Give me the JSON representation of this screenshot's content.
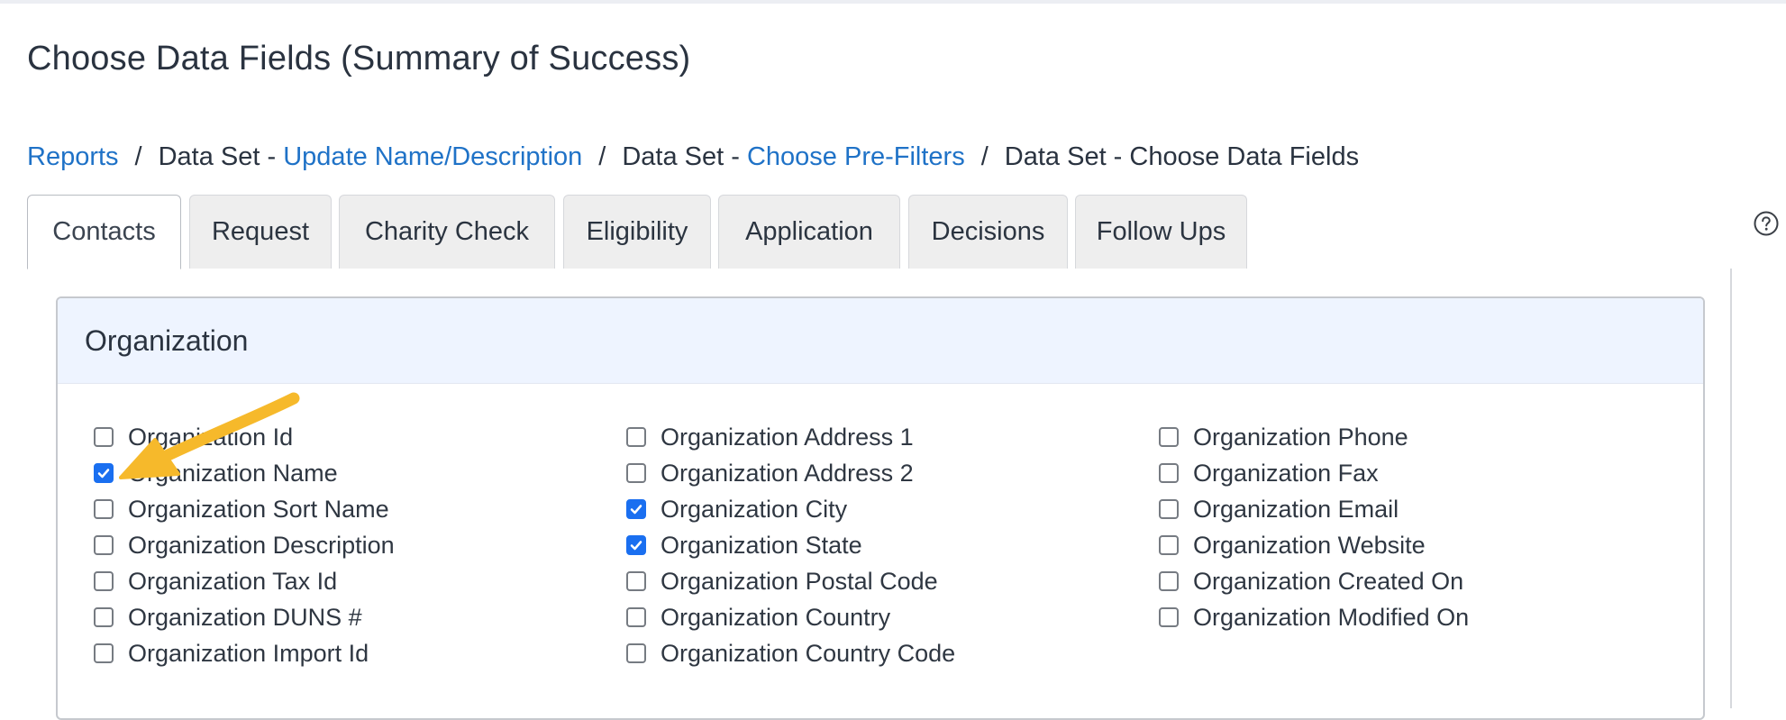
{
  "page": {
    "title": "Choose Data Fields (Summary of Success)"
  },
  "breadcrumb": {
    "reports": "Reports",
    "sep1": "/",
    "ds1_prefix": "Data Set - ",
    "ds1_link": "Update Name/Description",
    "sep2": "/",
    "ds2_prefix": "Data Set - ",
    "ds2_link": "Choose Pre-Filters",
    "sep3": "/",
    "current": "Data Set - Choose Data Fields"
  },
  "tabs": [
    {
      "label": "Contacts",
      "active": true
    },
    {
      "label": "Request"
    },
    {
      "label": "Charity Check"
    },
    {
      "label": "Eligibility"
    },
    {
      "label": "Application"
    },
    {
      "label": "Decisions"
    },
    {
      "label": "Follow Ups"
    }
  ],
  "help": {
    "icon": "question-circle-icon"
  },
  "section": {
    "title": "Organization",
    "columns": [
      [
        {
          "label": "Organization Id",
          "checked": false
        },
        {
          "label": "Organization Name",
          "checked": true
        },
        {
          "label": "Organization Sort Name",
          "checked": false
        },
        {
          "label": "Organization Description",
          "checked": false
        },
        {
          "label": "Organization Tax Id",
          "checked": false
        },
        {
          "label": "Organization DUNS #",
          "checked": false
        },
        {
          "label": "Organization Import Id",
          "checked": false
        }
      ],
      [
        {
          "label": "Organization Address 1",
          "checked": false
        },
        {
          "label": "Organization Address 2",
          "checked": false
        },
        {
          "label": "Organization City",
          "checked": true
        },
        {
          "label": "Organization State",
          "checked": true
        },
        {
          "label": "Organization Postal Code",
          "checked": false
        },
        {
          "label": "Organization Country",
          "checked": false
        },
        {
          "label": "Organization Country Code",
          "checked": false
        }
      ],
      [
        {
          "label": "Organization Phone",
          "checked": false
        },
        {
          "label": "Organization Fax",
          "checked": false
        },
        {
          "label": "Organization Email",
          "checked": false
        },
        {
          "label": "Organization Website",
          "checked": false
        },
        {
          "label": "Organization Created On",
          "checked": false
        },
        {
          "label": "Organization Modified On",
          "checked": false
        }
      ]
    ]
  },
  "annotation": {
    "icon": "arrow-annotation-icon",
    "color": "#f6b92b"
  }
}
